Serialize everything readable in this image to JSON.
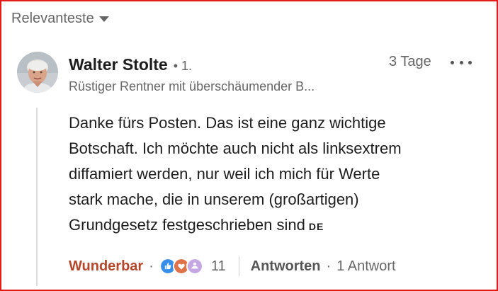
{
  "sort": {
    "label": "Relevanteste",
    "icon": "caret-down-icon"
  },
  "comment": {
    "author": {
      "name": "Walter Stolte",
      "degree": "• 1.",
      "headline": "Rüstiger Rentner mit überschäumender B..."
    },
    "timestamp": "3 Tage",
    "menu_icon": "more-horizontal-icon",
    "lines": [
      "Danke fürs Posten. Das ist eine ganz wichtige",
      "Botschaft. Ich möchte auch nicht als linksextrem",
      "diffamiert werden, nur weil ich mich für Werte",
      "stark mache, die in unserem (großartigen)",
      "Grundgesetz festgeschrieben sind"
    ],
    "flag": "DE",
    "actions": {
      "reaction_label": "Wunderbar",
      "dot1": "·",
      "reaction_icons": [
        "like-icon",
        "love-icon",
        "celebrate-icon"
      ],
      "reaction_count": "11",
      "reply_label": "Antworten",
      "dot2": "·",
      "reply_count": "1 Antwort"
    }
  },
  "colors": {
    "reaction_accent": "#b2472c",
    "frame": "#e4191a",
    "like": "#378fe9",
    "love": "#e0724a",
    "celebrate": "#c4a7e3"
  }
}
